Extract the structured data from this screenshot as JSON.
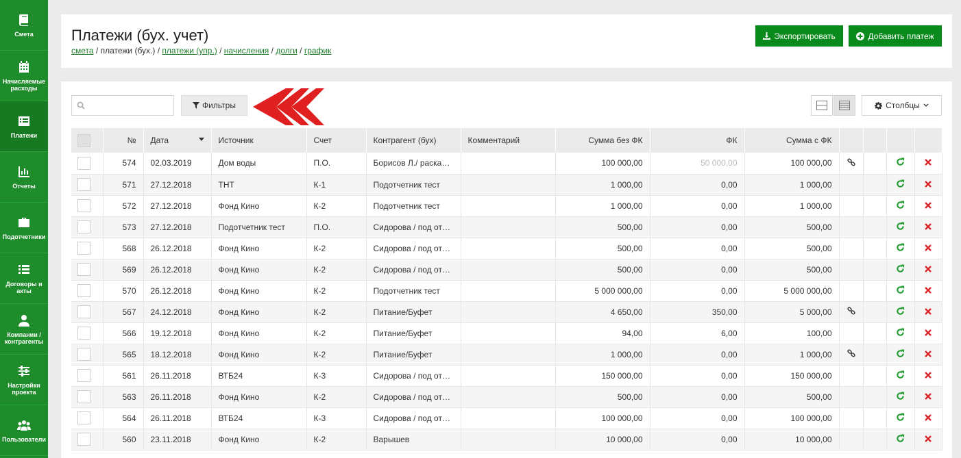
{
  "sidebar": {
    "items": [
      {
        "label": "Смета",
        "icon": "book-icon"
      },
      {
        "label": "Начисляемые расходы",
        "icon": "calendar-icon"
      },
      {
        "label": "Платежи",
        "icon": "list-alt-icon"
      },
      {
        "label": "Отчеты",
        "icon": "bar-chart-icon"
      },
      {
        "label": "Подотчетники",
        "icon": "briefcase-icon"
      },
      {
        "label": "Договоры и акты",
        "icon": "list-icon"
      },
      {
        "label": "Компании / контрагенты",
        "icon": "user-icon"
      },
      {
        "label": "Настройки проекта",
        "icon": "sliders-icon"
      },
      {
        "label": "Пользователи",
        "icon": "users-icon"
      }
    ]
  },
  "header": {
    "title": "Платежи (бух. учет)",
    "breadcrumb": {
      "smeta": "смета",
      "sep": " / ",
      "current": "платежи (бух.)",
      "upr": "платежи (упр.)",
      "accruals": "начисления",
      "debts": "долги",
      "schedule": "график"
    },
    "export_label": "Экспортировать",
    "add_label": "Добавить платеж"
  },
  "toolbar": {
    "search_placeholder": "",
    "filters_label": "Фильтры",
    "columns_label": "Столбцы"
  },
  "table": {
    "headers": {
      "num": "№",
      "date": "Дата",
      "source": "Источник",
      "account": "Счет",
      "counterparty": "Контрагент (бух)",
      "comment": "Комментарий",
      "sum_no_fk": "Сумма без ФК",
      "fk": "ФК",
      "sum_fk": "Сумма с ФК"
    },
    "rows": [
      {
        "num": "574",
        "date": "02.03.2019",
        "source": "Дом воды",
        "account": "П.О.",
        "counterparty": "Борисов Л./ раскадровки",
        "comment": "",
        "sum_no_fk": "100 000,00",
        "fk": "50 000,00",
        "fk_faded": true,
        "sum_fk": "100 000,00",
        "link": true
      },
      {
        "num": "571",
        "date": "27.12.2018",
        "source": "ТНТ",
        "account": "К-1",
        "counterparty": "Подотчетник тест",
        "comment": "",
        "sum_no_fk": "1 000,00",
        "fk": "0,00",
        "sum_fk": "1 000,00",
        "link": false
      },
      {
        "num": "572",
        "date": "27.12.2018",
        "source": "Фонд Кино",
        "account": "К-2",
        "counterparty": "Подотчетник тест",
        "comment": "",
        "sum_no_fk": "1 000,00",
        "fk": "0,00",
        "sum_fk": "1 000,00",
        "link": false
      },
      {
        "num": "573",
        "date": "27.12.2018",
        "source": "Подотчетник тест",
        "account": "П.О.",
        "counterparty": "Сидорова / под отчет",
        "comment": "",
        "sum_no_fk": "500,00",
        "fk": "0,00",
        "sum_fk": "500,00",
        "link": false
      },
      {
        "num": "568",
        "date": "26.12.2018",
        "source": "Фонд Кино",
        "account": "К-2",
        "counterparty": "Сидорова / под отчет",
        "comment": "",
        "sum_no_fk": "500,00",
        "fk": "0,00",
        "sum_fk": "500,00",
        "link": false
      },
      {
        "num": "569",
        "date": "26.12.2018",
        "source": "Фонд Кино",
        "account": "К-2",
        "counterparty": "Сидорова / под отчет",
        "comment": "",
        "sum_no_fk": "500,00",
        "fk": "0,00",
        "sum_fk": "500,00",
        "link": false
      },
      {
        "num": "570",
        "date": "26.12.2018",
        "source": "Фонд Кино",
        "account": "К-2",
        "counterparty": "Подотчетник тест",
        "comment": "",
        "sum_no_fk": "5 000 000,00",
        "fk": "0,00",
        "sum_fk": "5 000 000,00",
        "link": false
      },
      {
        "num": "567",
        "date": "24.12.2018",
        "source": "Фонд Кино",
        "account": "К-2",
        "counterparty": "Питание/Буфет",
        "comment": "",
        "sum_no_fk": "4 650,00",
        "fk": "350,00",
        "sum_fk": "5 000,00",
        "link": true
      },
      {
        "num": "566",
        "date": "19.12.2018",
        "source": "Фонд Кино",
        "account": "К-2",
        "counterparty": "Питание/Буфет",
        "comment": "",
        "sum_no_fk": "94,00",
        "fk": "6,00",
        "sum_fk": "100,00",
        "link": false
      },
      {
        "num": "565",
        "date": "18.12.2018",
        "source": "Фонд Кино",
        "account": "К-2",
        "counterparty": "Питание/Буфет",
        "comment": "",
        "sum_no_fk": "1 000,00",
        "fk": "0,00",
        "sum_fk": "1 000,00",
        "link": true
      },
      {
        "num": "561",
        "date": "26.11.2018",
        "source": "ВТБ24",
        "account": "К-3",
        "counterparty": "Сидорова / под отчет",
        "comment": "",
        "sum_no_fk": "150 000,00",
        "fk": "0,00",
        "sum_fk": "150 000,00",
        "link": false
      },
      {
        "num": "563",
        "date": "26.11.2018",
        "source": "Фонд Кино",
        "account": "К-2",
        "counterparty": "Сидорова / под отчет",
        "comment": "",
        "sum_no_fk": "500,00",
        "fk": "0,00",
        "sum_fk": "500,00",
        "link": false
      },
      {
        "num": "564",
        "date": "26.11.2018",
        "source": "ВТБ24",
        "account": "К-3",
        "counterparty": "Сидорова / под отчет",
        "comment": "",
        "sum_no_fk": "100 000,00",
        "fk": "0,00",
        "sum_fk": "100 000,00",
        "link": false
      },
      {
        "num": "560",
        "date": "23.11.2018",
        "source": "Фонд Кино",
        "account": "К-2",
        "counterparty": "Варышев",
        "comment": "",
        "sum_no_fk": "10 000,00",
        "fk": "0,00",
        "sum_fk": "10 000,00",
        "link": false
      }
    ]
  },
  "colors": {
    "sidebar": "#1e8c2b",
    "primary_button": "#0a8a1d",
    "refresh_icon": "#1e9a2e",
    "delete_icon": "#d9262b",
    "arrow_annotation": "#e02020"
  }
}
